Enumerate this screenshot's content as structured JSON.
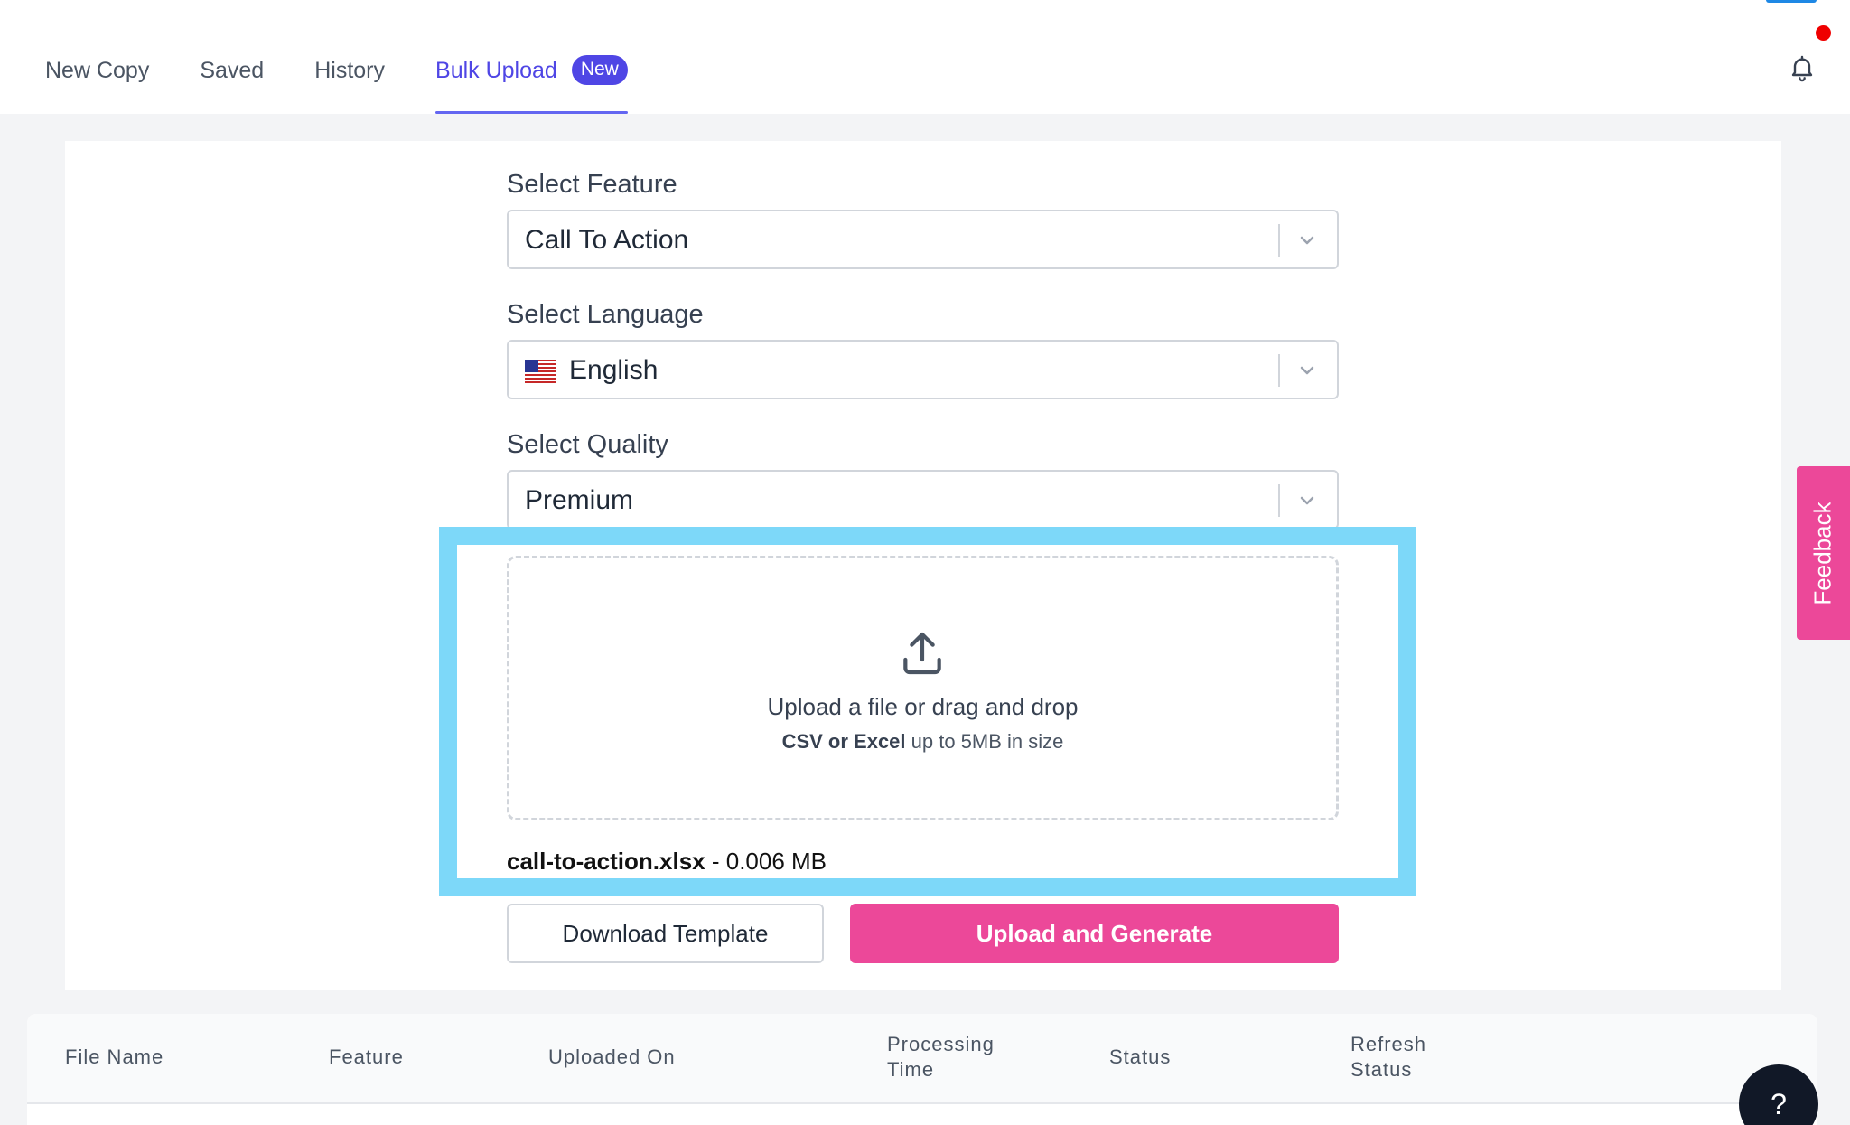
{
  "tabs": [
    {
      "label": "New Copy"
    },
    {
      "label": "Saved"
    },
    {
      "label": "History"
    },
    {
      "label": "Bulk Upload",
      "badge": "New"
    }
  ],
  "form": {
    "feature": {
      "label": "Select Feature",
      "value": "Call To Action"
    },
    "language": {
      "label": "Select Language",
      "value": "English",
      "flag_icon": "us-flag-icon"
    },
    "quality": {
      "label": "Select Quality",
      "value": "Premium"
    }
  },
  "dropzone": {
    "title": "Upload a file or drag and drop",
    "sub_bold": "CSV or Excel",
    "sub_rest": " up to 5MB in size"
  },
  "uploaded_file": {
    "name": "call-to-action.xlsx",
    "size": " - 0.006 MB"
  },
  "buttons": {
    "download": "Download Template",
    "upload": "Upload and Generate"
  },
  "table": {
    "headers": [
      {
        "line1": "File Name",
        "line2": ""
      },
      {
        "line1": "Feature",
        "line2": ""
      },
      {
        "line1": "Uploaded On",
        "line2": ""
      },
      {
        "line1": "Processing",
        "line2": "Time"
      },
      {
        "line1": "Status",
        "line2": ""
      },
      {
        "line1": "Refresh",
        "line2": "Status"
      }
    ]
  },
  "feedback": "Feedback",
  "help": "?",
  "colors": {
    "accent": "#4f46e5",
    "primary_button": "#ec4899",
    "highlight": "#7dd8f9",
    "notification_dot": "#ef0000"
  }
}
